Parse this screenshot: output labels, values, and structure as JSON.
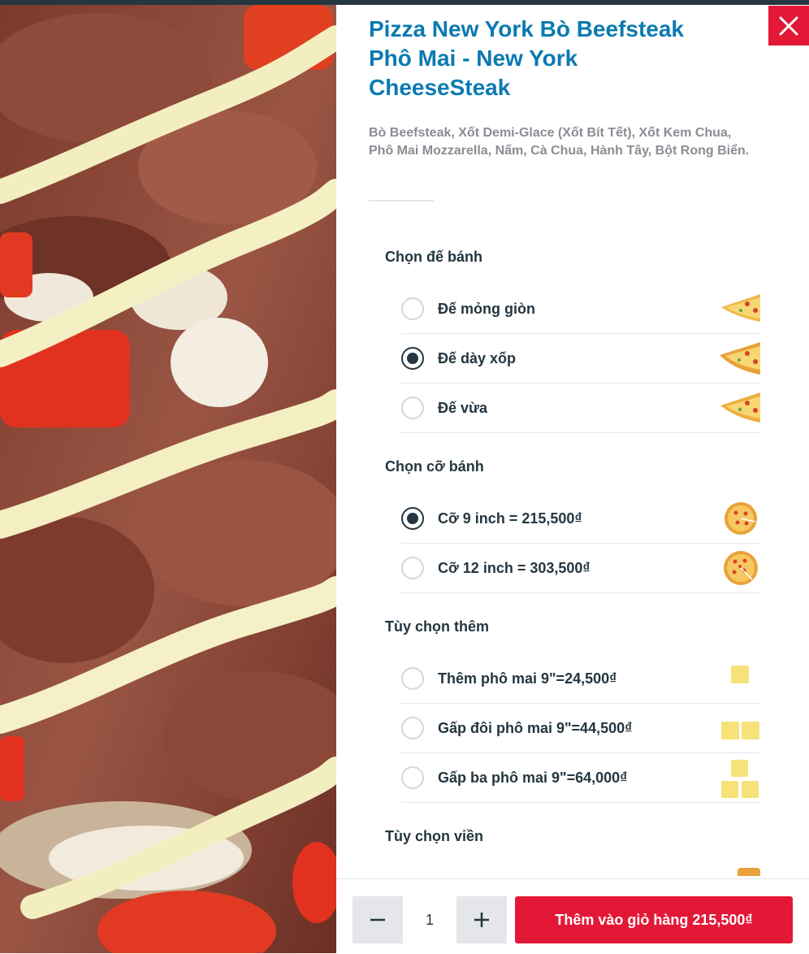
{
  "product": {
    "title_line1": "Pizza New York Bò Beefsteak",
    "title_line2": "Phô Mai - New York",
    "title_line3": "CheeseSteak",
    "description_line1": "Bò Beefsteak, Xốt Demi-Glace (Xốt Bít Tết), Xốt Kem Chua,",
    "description_line2": "Phô Mai Mozzarella, Nấm, Cà Chua, Hành Tây, Bột Rong Biển."
  },
  "sections": {
    "crust": {
      "title": "Chọn đế bánh",
      "options": [
        {
          "label": "Đế mỏng giòn",
          "selected": false,
          "icon": "thin-crust-slice-icon"
        },
        {
          "label": "Đế dày xốp",
          "selected": true,
          "icon": "thick-crust-slice-icon"
        },
        {
          "label": "Đế vừa",
          "selected": false,
          "icon": "medium-crust-slice-icon"
        }
      ]
    },
    "size": {
      "title": "Chọn cỡ bánh",
      "options": [
        {
          "label": "Cỡ 9 inch =  215,500₫",
          "selected": true,
          "icon": "pizza-9-inch-icon"
        },
        {
          "label": "Cỡ 12 inch =  303,500₫",
          "selected": false,
          "icon": "pizza-12-inch-icon"
        }
      ]
    },
    "extra": {
      "title": "Tùy chọn thêm",
      "options": [
        {
          "label": "Thêm phô mai 9\"=24,500₫",
          "selected": false,
          "icon": "cheese-single-icon"
        },
        {
          "label": "Gấp đôi phô mai 9\"=44,500₫",
          "selected": false,
          "icon": "cheese-double-icon"
        },
        {
          "label": "Gấp ba phô mai 9\"=64,000₫",
          "selected": false,
          "icon": "cheese-triple-icon"
        }
      ]
    },
    "crust_edge": {
      "title": "Tùy chọn viền"
    }
  },
  "footer": {
    "quantity": "1",
    "decrement_symbol": "−",
    "increment_symbol": "+",
    "add_to_cart_label": "Thêm vào giỏ hàng 215,500₫"
  },
  "colors": {
    "accent_red": "#e31837",
    "title_blue": "#0b7ab0",
    "text_dark": "#243640",
    "muted_grey": "#8a8d93"
  }
}
